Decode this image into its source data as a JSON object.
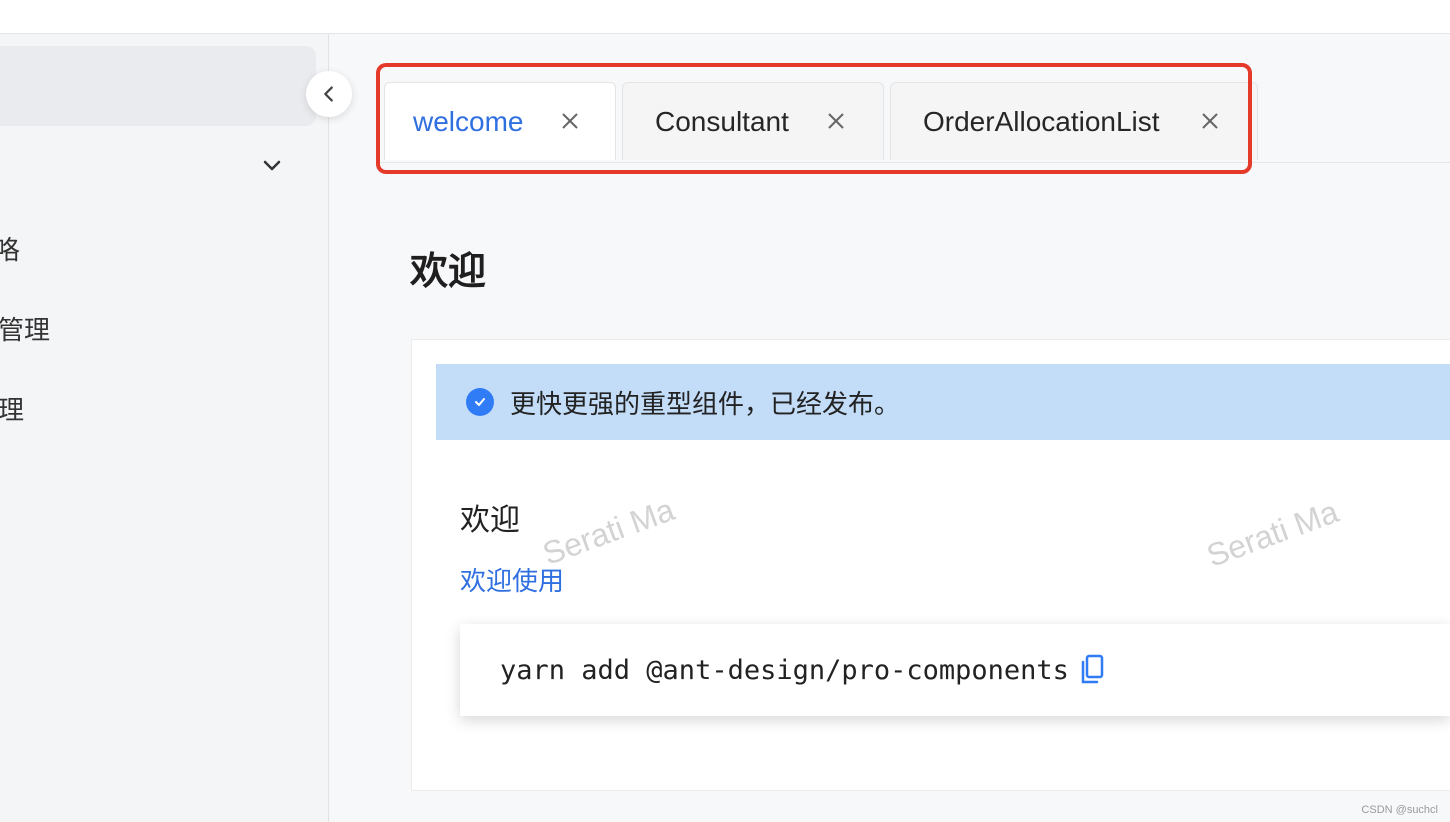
{
  "sidebar": {
    "items": [
      {
        "label": "咯"
      },
      {
        "label": "管理"
      },
      {
        "label": "理"
      }
    ]
  },
  "tabs": [
    {
      "label": "welcome",
      "active": true
    },
    {
      "label": "Consultant",
      "active": false
    },
    {
      "label": "OrderAllocationList",
      "active": false
    }
  ],
  "page": {
    "title": "欢迎"
  },
  "alert": {
    "message": "更快更强的重型组件，已经发布。"
  },
  "content": {
    "heading": "欢迎",
    "link_text": "欢迎使用",
    "code": "yarn add @ant-design/pro-components"
  },
  "watermark": {
    "text": "Serati Ma"
  },
  "footer": {
    "credit": "CSDN @suchcl"
  },
  "colors": {
    "accent": "#2f6fe0",
    "highlight_border": "#e53a2a",
    "alert_bg": "#c3dcf7"
  },
  "icons": [
    "chevron-left-icon",
    "chevron-down-icon",
    "close-icon",
    "check-circle-icon",
    "copy-icon"
  ]
}
